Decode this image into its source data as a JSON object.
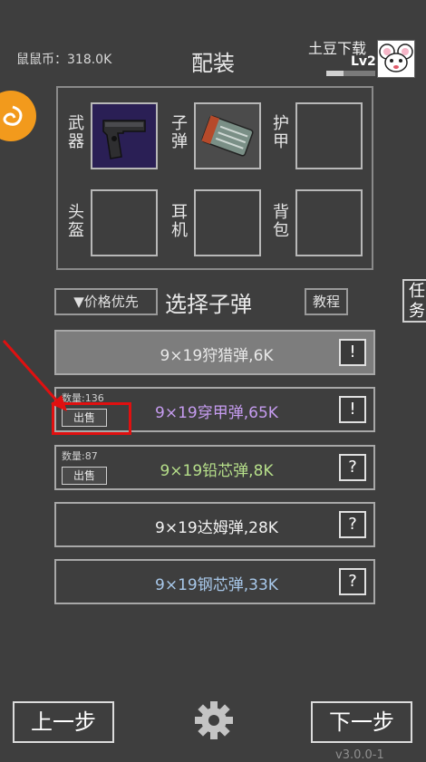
{
  "header": {
    "coin_label": "鼠鼠币：318.0K",
    "title": "配装",
    "username": "土豆下载",
    "level": "Lv2",
    "level_progress": 0.35
  },
  "equipment": {
    "slots": [
      {
        "label": "武器",
        "item_icon": "pistol-icon"
      },
      {
        "label": "子弹",
        "item_icon": "ammo-box-icon"
      },
      {
        "label": "护甲",
        "item_icon": ""
      },
      {
        "label": "头盔",
        "item_icon": ""
      },
      {
        "label": "耳机",
        "item_icon": ""
      },
      {
        "label": "背包",
        "item_icon": ""
      }
    ]
  },
  "controls": {
    "sort_label": "▼价格优先",
    "section_title": "选择子弹",
    "tutorial_label": "教程",
    "task_label": "任务"
  },
  "ammo_list": [
    {
      "name": "9×19狩猎弹,6K",
      "badge": "!",
      "color": "#e8e8e8",
      "quantity": "",
      "sell": ""
    },
    {
      "name": "9×19穿甲弹,65K",
      "badge": "!",
      "color": "#c69cf0",
      "quantity": "数量:136",
      "sell": "出售"
    },
    {
      "name": "9×19铅芯弹,8K",
      "badge": "?",
      "color": "#b6df8a",
      "quantity": "数量:87",
      "sell": "出售"
    },
    {
      "name": "9×19达姆弹,28K",
      "badge": "?",
      "color": "#f2f2f2",
      "quantity": "",
      "sell": ""
    },
    {
      "name": "9×19钢芯弹,33K",
      "badge": "?",
      "color": "#a8c8ea",
      "quantity": "",
      "sell": ""
    }
  ],
  "footer": {
    "prev_label": "上一步",
    "next_label": "下一步",
    "version": "v3.0.0-1"
  },
  "colors": {
    "background": "#3e3e3e",
    "highlight": "#e01010",
    "accent_orange": "#f29a1c"
  }
}
